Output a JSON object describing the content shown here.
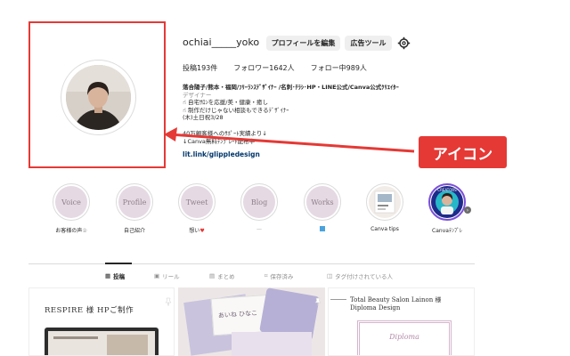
{
  "profile": {
    "username": "ochiai_____yoko",
    "edit_button": "プロフィールを編集",
    "ads_button": "広告ツール",
    "stats": {
      "posts": "投稿193件",
      "followers": "フォロワー1642人",
      "following": "フォロー中989人"
    },
    "bio": {
      "name": "落合陽子/熊本・福岡/ﾌﾘｰﾗﾝｽﾃﾞｻﾞｲﾅｰ /名刺･ﾁﾗｼ･HP・LINE公式/Canva公式ｸﾘｴｲﾀｰ",
      "category": "デザイナー",
      "line1": "☝ 自宅ｻﾛﾝを応援/美・健康・癒し",
      "line2": "☝ 制作だけじゃない相談もできるﾃﾞｻﾞｲﾅｰ",
      "line3": "(木)土日祝3/28",
      "line4": "40万顧客様へのｻﾎﾟｰﾄ実績より↓",
      "line5": "↓Canva無料ﾃﾝﾌﾟﾚｰﾄ配布中"
    },
    "link": "lit.link/glippledesign"
  },
  "annotation": {
    "label": "アイコン",
    "color": "#e53935"
  },
  "highlights": [
    {
      "title": "Voice",
      "label": "お客様の声"
    },
    {
      "title": "Profile",
      "label": "自己紹介"
    },
    {
      "title": "Tweet",
      "label": "想い"
    },
    {
      "title": "Blog",
      "label": ""
    },
    {
      "title": "Works",
      "label": ""
    },
    {
      "title": "",
      "label": "Canva tips"
    },
    {
      "title": "",
      "label": "Canvaﾃﾝﾌﾟﾚ"
    }
  ],
  "tabs": [
    {
      "label": "投稿",
      "icon": "grid-icon"
    },
    {
      "label": "リール",
      "icon": "reels-icon"
    },
    {
      "label": "まとめ",
      "icon": "guide-icon"
    },
    {
      "label": "保存済み",
      "icon": "bookmark-icon"
    },
    {
      "label": "タグ付けされている人",
      "icon": "tagged-icon"
    }
  ],
  "posts": [
    {
      "title": "RESPIRE 様 HPご制作"
    },
    {
      "title": "あいね ひなこ"
    },
    {
      "title": "Total Beauty Salon Lainon 様",
      "subtitle": "Diploma Design",
      "card": "Diploma"
    }
  ]
}
